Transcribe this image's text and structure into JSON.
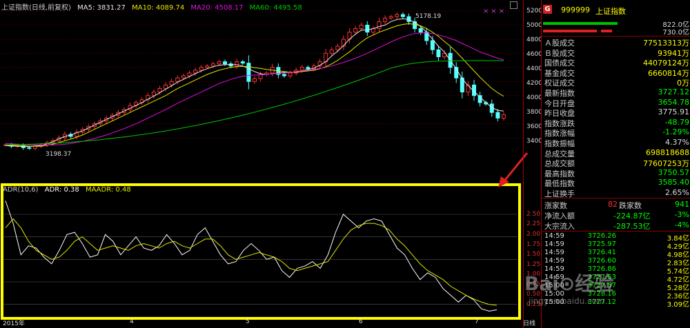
{
  "colors": {
    "up": "#ff3232",
    "down": "#54ffff",
    "ma5": "#e8e8e8",
    "ma10": "#e6e600",
    "ma20": "#e010e0",
    "ma60": "#00c800",
    "adr": "#ffffff",
    "maadr": "#e6e600",
    "frame": "#ffff00",
    "grid": "#7a0000",
    "accent": "#ff3030"
  },
  "main_legend": {
    "title": "上证指数(日线,前复权)",
    "ma5": "MA5: 3831.27",
    "ma10": "MA10: 4089.74",
    "ma20": "MA20: 4508.17",
    "ma60": "MA60: 4495.58"
  },
  "adr_legend": {
    "title": "ADR(10,6)",
    "adr": "ADR: 0.38",
    "maadr": "MAADR: 0.48"
  },
  "annotations": {
    "high": "5178.19",
    "low": "3198.37"
  },
  "toolbar": {
    "icons": "×××"
  },
  "price_axis": [
    "5200",
    "5000",
    "4800",
    "4600",
    "4400",
    "4200",
    "4000",
    "3800",
    "3600",
    "3400"
  ],
  "adr_axis": [
    "2.50",
    "2.25",
    "2.00",
    "1.75",
    "1.50",
    "1.25",
    "1.00",
    "0.75",
    "0.50",
    "0.25"
  ],
  "date_axis": [
    "2015年",
    "4",
    "5",
    "6",
    "7"
  ],
  "status": {
    "period": "日线"
  },
  "stock": {
    "icon": "G",
    "code": "999999",
    "name": "上证指数",
    "bar_up_value": "822.0亿",
    "bar_down_value": "730.0亿"
  },
  "stats": [
    {
      "label": "Ａ股成交",
      "value": "77513313万",
      "color": "#ffff00"
    },
    {
      "label": "Ｂ股成交",
      "value": "93941万",
      "color": "#ffff00"
    },
    {
      "label": "国债成交",
      "value": "44079124万",
      "color": "#ffff00"
    },
    {
      "label": "基金成交",
      "value": "6660814万",
      "color": "#ffff00"
    },
    {
      "label": "权证成交",
      "value": "0万",
      "color": "#ffff00"
    },
    {
      "label": "最新指数",
      "value": "3727.12",
      "color": "#00ff00"
    },
    {
      "label": "今日开盘",
      "value": "3654.78",
      "color": "#00ff00"
    },
    {
      "label": "昨日收盘",
      "value": "3775.91",
      "color": "#dddddd"
    },
    {
      "label": "指数涨跌",
      "value": "-48.79",
      "color": "#00ff00"
    },
    {
      "label": "指数涨幅",
      "value": "-1.29%",
      "color": "#00ff00"
    },
    {
      "label": "指数振幅",
      "value": "4.37%",
      "color": "#dddddd"
    },
    {
      "label": "总成交量",
      "value": "698818688",
      "color": "#ffff00"
    },
    {
      "label": "总成交额",
      "value": "77607253万",
      "color": "#ffff00"
    },
    {
      "label": "最高指数",
      "value": "3750.57",
      "color": "#00ff00"
    },
    {
      "label": "最低指数",
      "value": "3585.40",
      "color": "#00ff00"
    },
    {
      "label": "上证换手",
      "value": "2.65%",
      "color": "#dddddd"
    }
  ],
  "breadth": {
    "up_label": "涨家数",
    "up_value": "82",
    "down_label": "跌家数",
    "down_value": "941"
  },
  "flows": [
    {
      "label": "净流入额",
      "value": "-224.87亿",
      "pct": "-3%"
    },
    {
      "label": "大宗流入",
      "value": "-287.53亿",
      "pct": "-4%"
    }
  ],
  "ticks": [
    {
      "time": "14:59",
      "price": "3726.26",
      "vol": "3.84亿"
    },
    {
      "time": "14:59",
      "price": "3725.97",
      "vol": "4.29亿"
    },
    {
      "time": "14:59",
      "price": "3726.41",
      "vol": "4.98亿"
    },
    {
      "time": "14:59",
      "price": "3726.60",
      "vol": "2.83亿"
    },
    {
      "time": "14:59",
      "price": "3726.86",
      "vol": "5.74亿"
    },
    {
      "time": "14:59",
      "price": "3727.53",
      "vol": "4.72亿"
    },
    {
      "time": "15:00",
      "price": "3727.57",
      "vol": "5.28亿"
    },
    {
      "time": "15:00",
      "price": "3728.16",
      "vol": "2.36亿"
    },
    {
      "time": "15:00",
      "price": "3727.12",
      "vol": "3.09亿"
    }
  ],
  "watermark": {
    "main": "Bai⊙经验",
    "sub": "jingyan.baidu.com"
  },
  "adr_chart": {
    "adr": [
      2.8,
      2.3,
      1.6,
      1.8,
      1.75,
      1.55,
      1.4,
      1.7,
      2.05,
      2.1,
      1.85,
      1.55,
      1.6,
      2.05,
      1.9,
      1.6,
      1.8,
      2.0,
      1.75,
      1.7,
      1.8,
      2.05,
      1.85,
      1.6,
      1.7,
      2.05,
      2.2,
      1.9,
      1.6,
      1.4,
      1.45,
      1.7,
      1.85,
      1.7,
      1.5,
      1.55,
      1.25,
      1.1,
      1.3,
      1.35,
      1.45,
      1.3,
      1.6,
      2.1,
      2.5,
      2.35,
      2.2,
      2.35,
      2.4,
      2.35,
      2.05,
      1.75,
      1.6,
      1.3,
      1.05,
      1.2,
      1.1,
      0.85,
      0.7,
      0.55,
      0.7,
      0.6,
      0.4,
      0.35,
      0.38
    ],
    "maadr": [
      2.2,
      2.4,
      2.2,
      1.9,
      1.7,
      1.6,
      1.5,
      1.55,
      1.7,
      1.9,
      2.0,
      1.85,
      1.7,
      1.75,
      1.8,
      1.75,
      1.7,
      1.8,
      1.85,
      1.8,
      1.75,
      1.85,
      1.9,
      1.8,
      1.75,
      1.85,
      1.95,
      1.95,
      1.8,
      1.6,
      1.5,
      1.55,
      1.6,
      1.65,
      1.6,
      1.55,
      1.45,
      1.3,
      1.25,
      1.3,
      1.35,
      1.4,
      1.45,
      1.7,
      1.95,
      2.15,
      2.25,
      2.3,
      2.3,
      2.25,
      2.15,
      1.95,
      1.8,
      1.6,
      1.4,
      1.25,
      1.15,
      1.05,
      0.9,
      0.8,
      0.7,
      0.62,
      0.55,
      0.5,
      0.48
    ]
  },
  "price_chart": {
    "close": [
      3300,
      3280,
      3290,
      3260,
      3250,
      3280,
      3300,
      3330,
      3360,
      3400,
      3450,
      3420,
      3480,
      3520,
      3560,
      3600,
      3640,
      3680,
      3720,
      3760,
      3800,
      3860,
      3900,
      3940,
      4000,
      4050,
      4100,
      4150,
      4200,
      4250,
      4280,
      4320,
      4360,
      4400,
      4420,
      4450,
      4480,
      4450,
      4420,
      4480,
      4460,
      4200,
      4240,
      4300,
      4320,
      4400,
      4300,
      4280,
      4320,
      4360,
      4400,
      4380,
      4420,
      4480,
      4600,
      4650,
      4700,
      4800,
      4900,
      4950,
      5000,
      4900,
      4950,
      5050,
      5100,
      5120,
      5150,
      5120,
      5050,
      4950,
      4900,
      4780,
      4650,
      4550,
      4600,
      4400,
      4250,
      4050,
      4150,
      4000,
      3900,
      3880,
      3760,
      3680,
      3727
    ],
    "ma5": [
      3290,
      3285,
      3280,
      3278,
      3276,
      3284,
      3290,
      3315,
      3345,
      3385,
      3420,
      3440,
      3470,
      3500,
      3540,
      3580,
      3620,
      3660,
      3700,
      3740,
      3780,
      3820,
      3860,
      3900,
      3950,
      3990,
      4040,
      4090,
      4140,
      4190,
      4230,
      4270,
      4310,
      4350,
      4380,
      4410,
      4430,
      4440,
      4440,
      4440,
      4420,
      4380,
      4340,
      4310,
      4300,
      4310,
      4320,
      4330,
      4330,
      4340,
      4350,
      4370,
      4390,
      4430,
      4480,
      4560,
      4630,
      4710,
      4800,
      4870,
      4930,
      4930,
      4950,
      4980,
      5000,
      5050,
      5080,
      5090,
      5080,
      5040,
      4980,
      4900,
      4800,
      4700,
      4620,
      4500,
      4380,
      4240,
      4140,
      4060,
      3980,
      3900,
      3830,
      3790,
      3780
    ],
    "ma10": [
      3300,
      3295,
      3290,
      3286,
      3282,
      3281,
      3282,
      3292,
      3310,
      3332,
      3360,
      3380,
      3410,
      3440,
      3480,
      3520,
      3560,
      3600,
      3640,
      3680,
      3720,
      3760,
      3800,
      3840,
      3880,
      3920,
      3960,
      4000,
      4050,
      4100,
      4140,
      4180,
      4220,
      4260,
      4300,
      4330,
      4360,
      4380,
      4400,
      4410,
      4415,
      4410,
      4395,
      4385,
      4370,
      4360,
      4350,
      4340,
      4330,
      4330,
      4340,
      4350,
      4360,
      4380,
      4410,
      4450,
      4500,
      4560,
      4620,
      4690,
      4760,
      4820,
      4860,
      4900,
      4930,
      4960,
      4990,
      5010,
      5020,
      5010,
      4990,
      4950,
      4900,
      4840,
      4770,
      4700,
      4620,
      4530,
      4440,
      4350,
      4260,
      4180,
      4100,
      4040,
      3990
    ],
    "ma20": [
      3320,
      3315,
      3310,
      3305,
      3300,
      3298,
      3296,
      3296,
      3298,
      3302,
      3310,
      3320,
      3335,
      3350,
      3370,
      3390,
      3415,
      3440,
      3470,
      3500,
      3530,
      3565,
      3600,
      3640,
      3680,
      3720,
      3760,
      3800,
      3845,
      3890,
      3930,
      3970,
      4010,
      4050,
      4090,
      4130,
      4170,
      4200,
      4230,
      4255,
      4275,
      4285,
      4290,
      4295,
      4300,
      4310,
      4315,
      4320,
      4330,
      4340,
      4350,
      4360,
      4370,
      4385,
      4400,
      4420,
      4445,
      4470,
      4500,
      4530,
      4565,
      4600,
      4640,
      4680,
      4720,
      4760,
      4800,
      4830,
      4860,
      4880,
      4890,
      4890,
      4880,
      4860,
      4840,
      4810,
      4780,
      4740,
      4700,
      4660,
      4620,
      4590,
      4560,
      4530,
      4508
    ],
    "ma60": [
      3300,
      3302,
      3304,
      3306,
      3308,
      3311,
      3314,
      3318,
      3322,
      3327,
      3332,
      3338,
      3344,
      3351,
      3358,
      3366,
      3374,
      3383,
      3392,
      3402,
      3412,
      3423,
      3434,
      3446,
      3458,
      3471,
      3484,
      3498,
      3512,
      3527,
      3542,
      3558,
      3574,
      3591,
      3608,
      3626,
      3644,
      3663,
      3682,
      3702,
      3722,
      3743,
      3764,
      3786,
      3808,
      3831,
      3854,
      3878,
      3902,
      3927,
      3952,
      3978,
      4004,
      4031,
      4058,
      4086,
      4114,
      4143,
      4172,
      4202,
      4232,
      4263,
      4294,
      4326,
      4358,
      4390,
      4412,
      4432,
      4448,
      4460,
      4470,
      4478,
      4484,
      4488,
      4491,
      4493,
      4494,
      4495,
      4496,
      4496,
      4496,
      4496,
      4496,
      4496,
      4495.58
    ]
  }
}
